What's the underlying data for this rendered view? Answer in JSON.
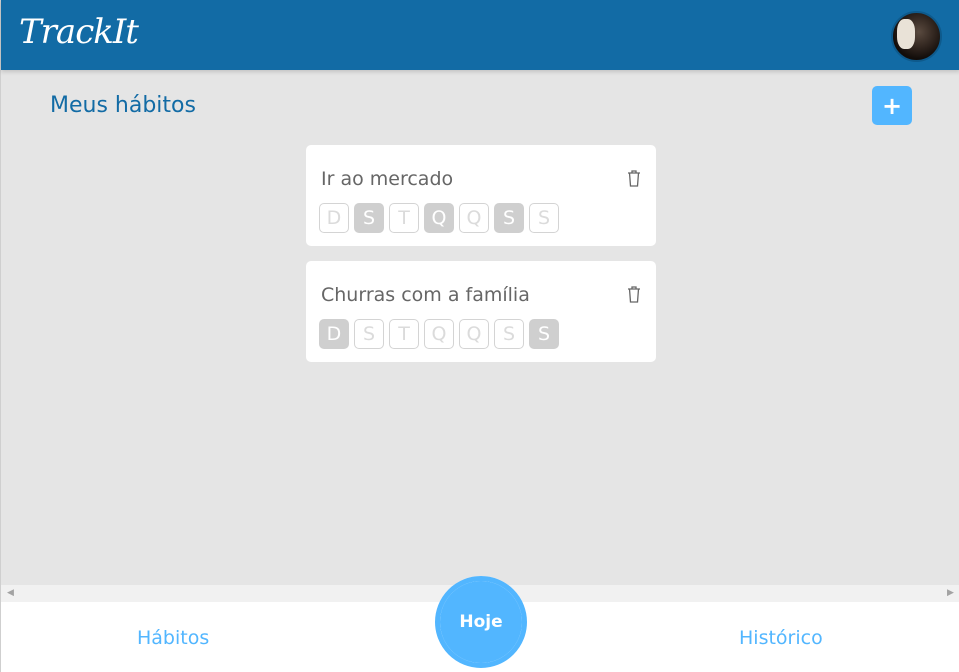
{
  "header": {
    "logo": "TrackIt",
    "avatar_icon": "user-avatar"
  },
  "main": {
    "title": "Meus hábitos",
    "add_label": "+",
    "habits": [
      {
        "name": "Ir ao mercado",
        "days": [
          "D",
          "S",
          "T",
          "Q",
          "Q",
          "S",
          "S"
        ],
        "selected": [
          false,
          true,
          false,
          true,
          false,
          true,
          false
        ]
      },
      {
        "name": "Churras com a família",
        "days": [
          "D",
          "S",
          "T",
          "Q",
          "Q",
          "S",
          "S"
        ],
        "selected": [
          true,
          false,
          false,
          false,
          false,
          false,
          true
        ]
      }
    ]
  },
  "footer": {
    "habits_label": "Hábitos",
    "today_label": "Hoje",
    "history_label": "Histórico"
  },
  "colors": {
    "brand": "#126ba5",
    "accent": "#52b6ff",
    "background": "#e5e5e5"
  }
}
